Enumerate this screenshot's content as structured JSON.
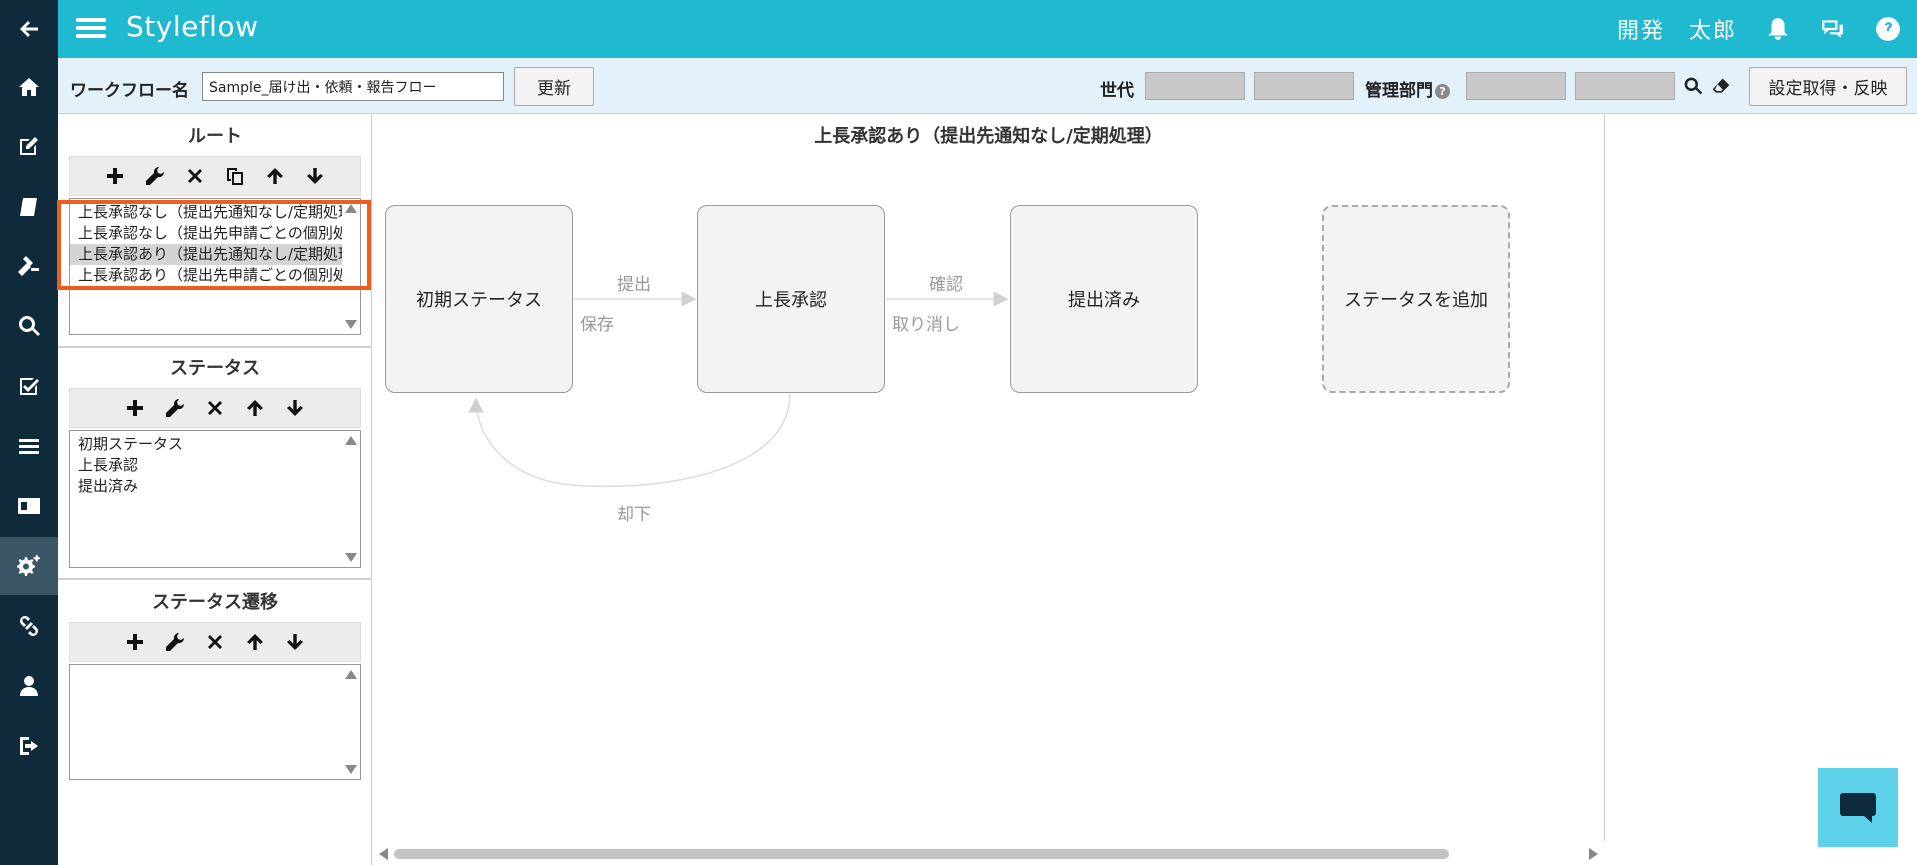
{
  "app": {
    "title": "Styleflow",
    "user_name": "開発　太郎"
  },
  "toolbar": {
    "workflow_label": "ワークフロー名",
    "workflow_value": "Sample_届け出・依頼・報告フロー",
    "update_label": "更新",
    "generation_label": "世代",
    "dept_label": "管理部門",
    "dept_help": "?",
    "fetch_apply_label": "設定取得・反映"
  },
  "route": {
    "title": "ルート",
    "items": [
      "上長承認なし（提出先通知なし/定期処理",
      "上長承認なし（提出先申請ごとの個別処理",
      "上長承認あり（提出先通知なし/定期処理",
      "上長承認あり（提出先申請ごとの個別処理"
    ],
    "selected_index": 2
  },
  "status": {
    "title": "ステータス",
    "items": [
      "初期ステータス",
      "上長承認",
      "提出済み"
    ]
  },
  "transition": {
    "title": "ステータス遷移",
    "items": []
  },
  "canvas": {
    "title": "上長承認あり（提出先通知なし/定期処理）",
    "nodes": [
      "初期ステータス",
      "上長承認",
      "提出済み"
    ],
    "add_node_label": "ステータスを追加",
    "edges": {
      "submit": "提出",
      "save": "保存",
      "confirm": "確認",
      "cancel": "取り消し",
      "reject": "却下"
    }
  },
  "sidebar_icons": [
    "back-arrow-icon",
    "home-icon",
    "edit-icon",
    "book-icon",
    "gavel-icon",
    "search-icon",
    "checkbox-icon",
    "list-icon",
    "id-card-icon",
    "gears-icon",
    "link-icon",
    "user-icon",
    "logout-icon"
  ],
  "colors": {
    "header": "#1fb9d0",
    "rail": "#0e2a3b",
    "toolbar": "#e2f1fa",
    "highlight": "#ee5d1e",
    "chat": "#5ed2ea"
  }
}
